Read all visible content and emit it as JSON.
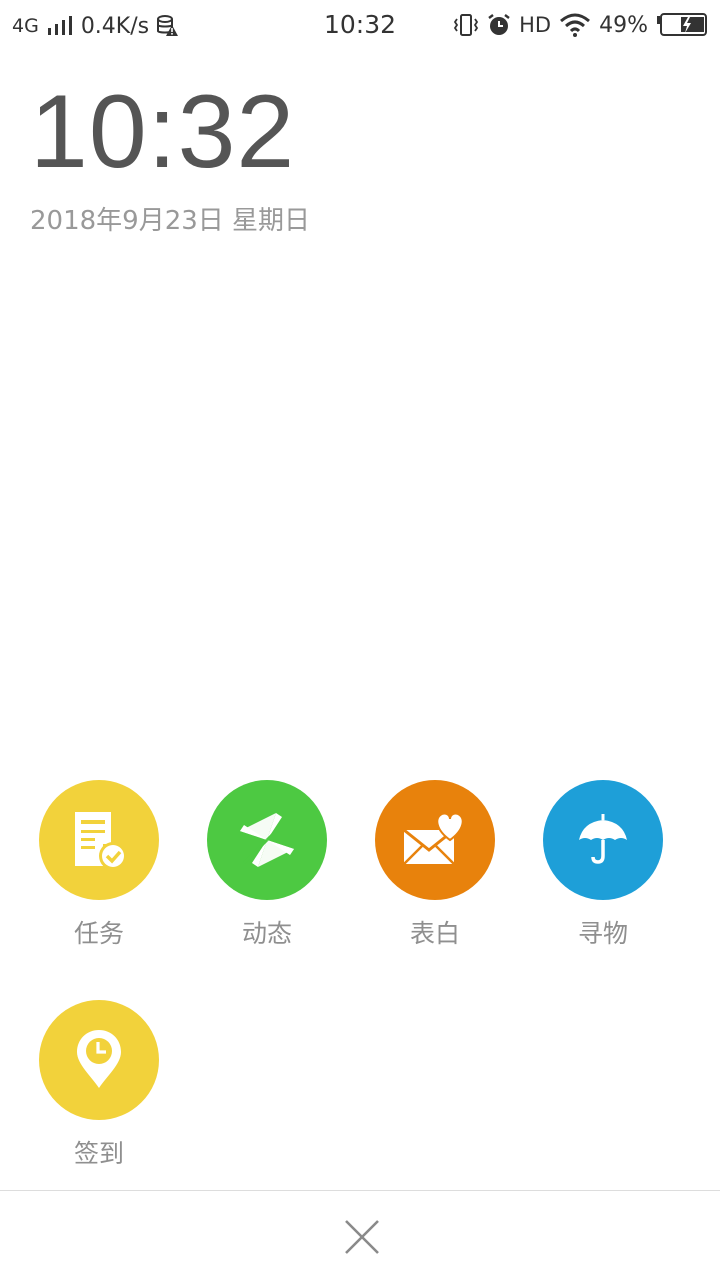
{
  "status_bar": {
    "network": "4G",
    "speed": "0.4K/s",
    "time": "10:32",
    "hd": "HD",
    "battery": "49%"
  },
  "clock": {
    "time": "10:32",
    "date": "2018年9月23日 星期日"
  },
  "shortcuts": [
    {
      "label": "任务",
      "color": "#F2D23B",
      "icon": "task-list-icon"
    },
    {
      "label": "动态",
      "color": "#4DC942",
      "icon": "pinwheel-icon"
    },
    {
      "label": "表白",
      "color": "#E8820C",
      "icon": "love-letter-icon"
    },
    {
      "label": "寻物",
      "color": "#1E9FD8",
      "icon": "umbrella-icon"
    },
    {
      "label": "签到",
      "color": "#F2D23B",
      "icon": "location-clock-icon"
    }
  ],
  "close_icon": "close-icon"
}
